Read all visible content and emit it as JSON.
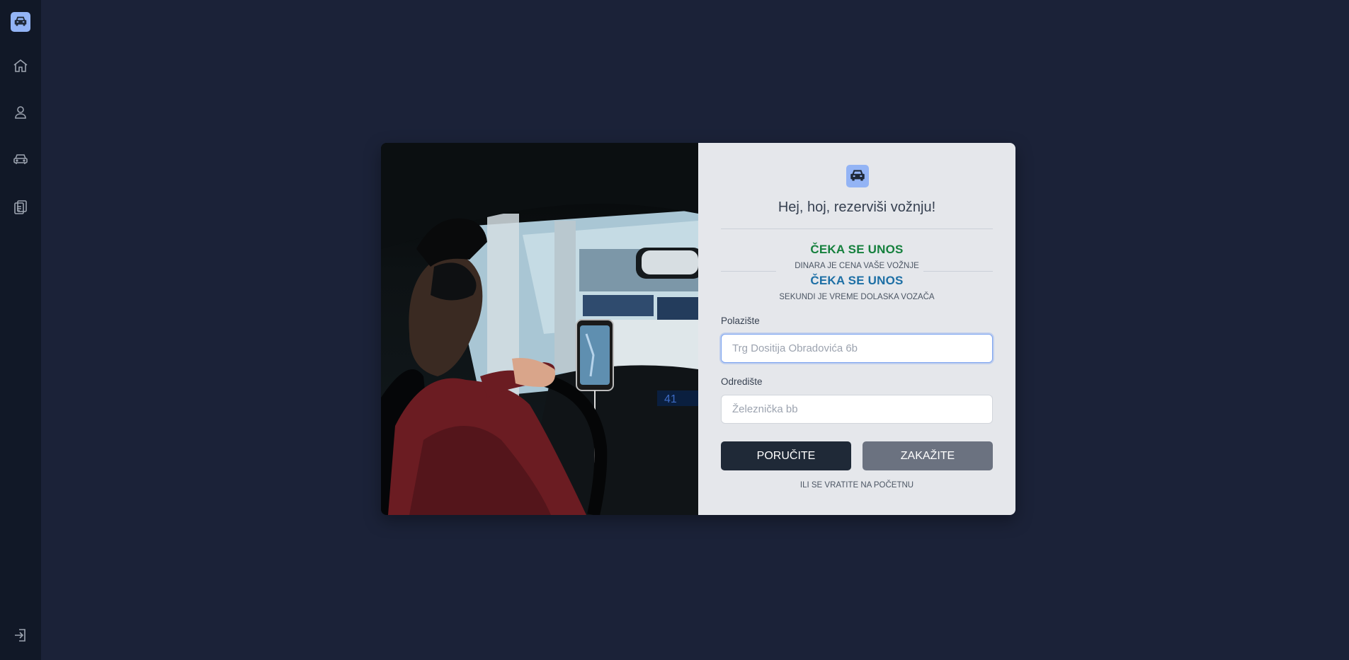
{
  "sidebar": {
    "items": [
      {
        "name": "home",
        "icon": "home-icon"
      },
      {
        "name": "profile",
        "icon": "user-icon"
      },
      {
        "name": "rides",
        "icon": "car-icon"
      },
      {
        "name": "history",
        "icon": "clipboard-icon"
      }
    ],
    "logout_icon": "logout-icon",
    "logo_icon": "taxi-icon"
  },
  "card": {
    "photo_alt": "driver-with-phone-navigation",
    "greeting": "Hej, hoj, rezerviši vožnju!",
    "price": {
      "value": "ČEKA SE UNOS",
      "note": "DINARA JE CENA VAŠE VOŽNJE",
      "color": "#15803d"
    },
    "eta": {
      "value": "ČEKA SE UNOS",
      "note": "SEKUNDI JE VREME DOLASKA VOZAČA",
      "color": "#1d6fa5"
    },
    "origin": {
      "label": "Polazište",
      "value": "",
      "placeholder": "Trg Dositija Obradovića 6b"
    },
    "destination": {
      "label": "Odredište",
      "value": "",
      "placeholder": "Železnička bb"
    },
    "order_button": "PORUČITE",
    "schedule_button": "ZAKAŽITE",
    "back_link": "ILI SE VRATITE NA POČETNU"
  },
  "colors": {
    "background": "#1b2238",
    "sidebar": "#111827",
    "panel": "#e5e7eb",
    "accent": "#93b4f5"
  }
}
